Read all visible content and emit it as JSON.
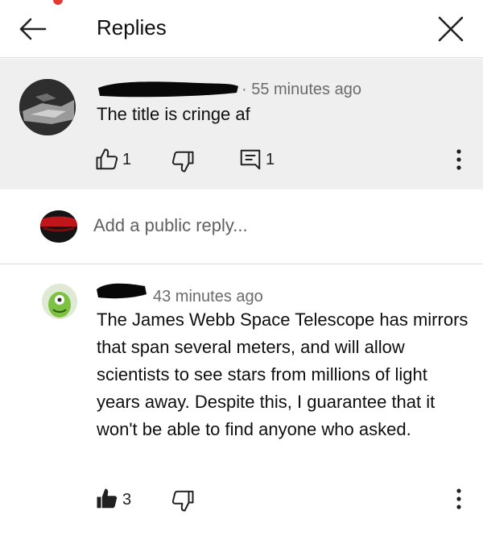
{
  "header": {
    "title": "Replies"
  },
  "parent_comment": {
    "time": "55 minutes ago",
    "text": "The title is cringe af",
    "likes": "1",
    "replies": "1"
  },
  "reply_box": {
    "placeholder": "Add a public reply..."
  },
  "reply_comment": {
    "time": "43 minutes ago",
    "text": "The James Webb Space Telescope has mirrors that span several meters, and will allow scientists to see stars from millions of light years away. Despite this, I guarantee that it won't be able to find anyone who asked.",
    "likes": "3"
  },
  "icons": {
    "back": "arrow-left-icon",
    "close": "close-icon",
    "like": "thumbs-up-icon",
    "dislike": "thumbs-down-icon",
    "reply": "comment-icon",
    "more": "more-vert-icon"
  },
  "colors": {
    "highlight_background": "#efefef",
    "secondary_text": "#6b6b6b",
    "recording_dot": "#e53935"
  }
}
